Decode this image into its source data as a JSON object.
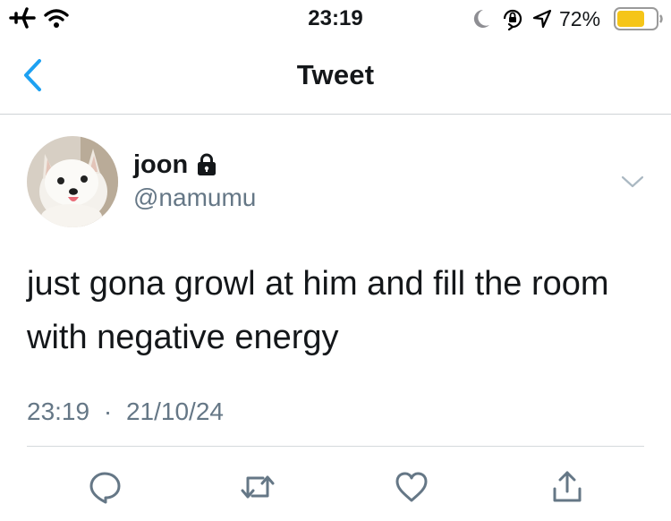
{
  "status_bar": {
    "time": "23:19",
    "battery_percent": "72%",
    "battery_level": 0.72,
    "battery_color": "#f5c518",
    "icons": [
      "airplane-icon",
      "wifi-icon",
      "moon-icon",
      "orientation-lock-icon",
      "location-icon",
      "battery-icon"
    ]
  },
  "nav": {
    "title": "Tweet",
    "back_icon": "chevron-left-icon",
    "accent_color": "#1da1f2"
  },
  "tweet": {
    "display_name": "joon",
    "protected": true,
    "username": "@namumu",
    "text": "just gona growl at him and fill the room with negative energy",
    "time": "23:19",
    "separator": "·",
    "date": "21/10/24",
    "avatar": "white-dog-avatar"
  },
  "actions": [
    {
      "name": "reply",
      "icon": "reply-icon"
    },
    {
      "name": "retweet",
      "icon": "retweet-icon"
    },
    {
      "name": "like",
      "icon": "heart-icon"
    },
    {
      "name": "share",
      "icon": "share-icon"
    }
  ],
  "colors": {
    "secondary_text": "#657786",
    "icon_gray": "#657786",
    "divider": "#cfd3d6"
  }
}
